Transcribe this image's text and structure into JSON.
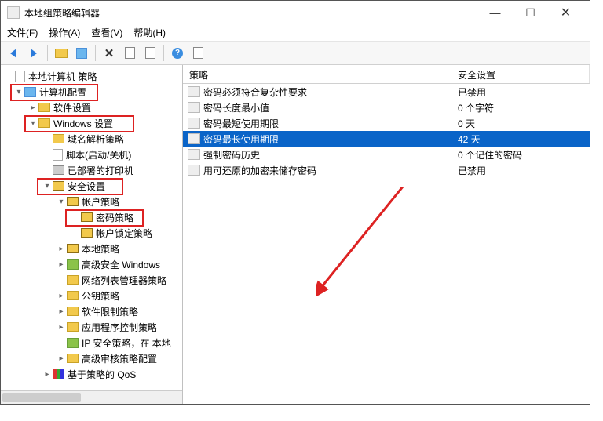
{
  "window": {
    "title": "本地组策略编辑器"
  },
  "menu": {
    "file": "文件(F)",
    "action": "操作(A)",
    "view": "查看(V)",
    "help": "帮助(H)"
  },
  "tree": {
    "root": "本地计算机 策略",
    "computer_config": "计算机配置",
    "software_settings": "软件设置",
    "windows_settings": "Windows 设置",
    "dns_policy": "域名解析策略",
    "scripts": "脚本(启动/关机)",
    "deployed_printers": "已部署的打印机",
    "security_settings": "安全设置",
    "account_policy": "帐户策略",
    "password_policy": "密码策略",
    "lockout_policy": "帐户锁定策略",
    "local_policy": "本地策略",
    "adv_windows": "高级安全 Windows",
    "network_list": "网络列表管理器策略",
    "pubkey_policy": "公钥策略",
    "software_restrict": "软件限制策略",
    "app_control": "应用程序控制策略",
    "ip_security": "IP 安全策略，在 本地",
    "audit_policy": "高级审核策略配置",
    "qos": "基于策略的 QoS"
  },
  "list": {
    "header_policy": "策略",
    "header_setting": "安全设置",
    "rows": [
      {
        "policy": "密码必须符合复杂性要求",
        "setting": "已禁用"
      },
      {
        "policy": "密码长度最小值",
        "setting": "0 个字符"
      },
      {
        "policy": "密码最短使用期限",
        "setting": "0 天"
      },
      {
        "policy": "密码最长使用期限",
        "setting": "42 天"
      },
      {
        "policy": "强制密码历史",
        "setting": "0 个记住的密码"
      },
      {
        "policy": "用可还原的加密来储存密码",
        "setting": "已禁用"
      }
    ],
    "selected_index": 3
  }
}
